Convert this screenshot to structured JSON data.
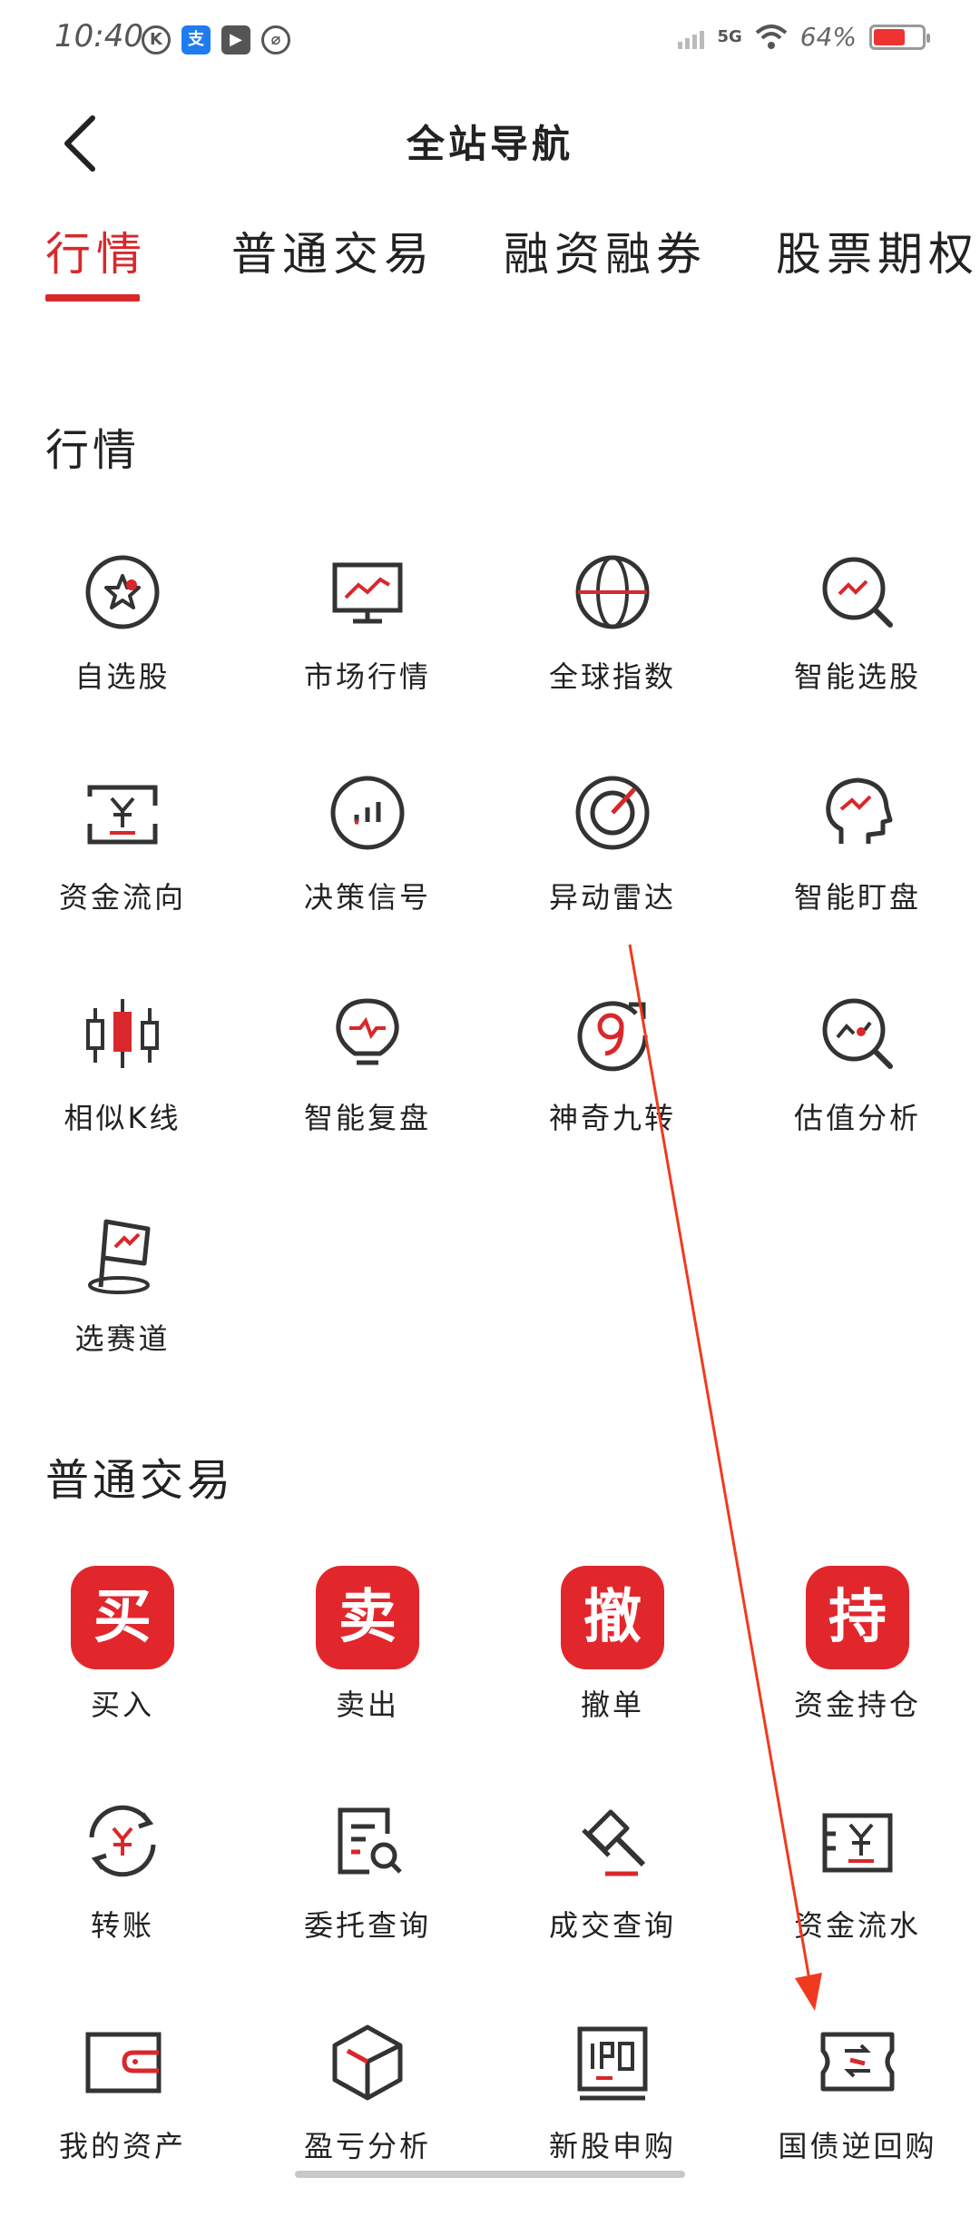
{
  "status_bar": {
    "time": "10:40",
    "network": "5G",
    "battery": "64%",
    "left_icons": [
      "k-circle-icon",
      "alipay-icon",
      "play-icon",
      "leaf-icon"
    ]
  },
  "header": {
    "title": "全站导航"
  },
  "tabs": [
    {
      "label": "行情",
      "active": true
    },
    {
      "label": "普通交易",
      "active": false
    },
    {
      "label": "融资融券",
      "active": false
    },
    {
      "label": "股票期权",
      "active": false
    }
  ],
  "sections": {
    "market": {
      "title": "行情",
      "items": [
        {
          "label": "自选股",
          "icon": "star-circle-icon"
        },
        {
          "label": "市场行情",
          "icon": "monitor-chart-icon"
        },
        {
          "label": "全球指数",
          "icon": "globe-icon"
        },
        {
          "label": "智能选股",
          "icon": "magnifier-chart-icon"
        },
        {
          "label": "资金流向",
          "icon": "yen-flow-icon"
        },
        {
          "label": "决策信号",
          "icon": "bar-signal-icon"
        },
        {
          "label": "异动雷达",
          "icon": "radar-icon"
        },
        {
          "label": "智能盯盘",
          "icon": "head-chart-icon"
        },
        {
          "label": "相似K线",
          "icon": "candlestick-icon"
        },
        {
          "label": "智能复盘",
          "icon": "bulb-chart-icon"
        },
        {
          "label": "神奇九转",
          "icon": "nine-arrow-icon"
        },
        {
          "label": "估值分析",
          "icon": "magnifier-dot-icon"
        },
        {
          "label": "选赛道",
          "icon": "flag-track-icon"
        }
      ]
    },
    "trade": {
      "title": "普通交易",
      "items": [
        {
          "label": "买入",
          "icon": "buy-tile-icon",
          "tile": "买"
        },
        {
          "label": "卖出",
          "icon": "sell-tile-icon",
          "tile": "卖"
        },
        {
          "label": "撤单",
          "icon": "cancel-tile-icon",
          "tile": "撤"
        },
        {
          "label": "资金持仓",
          "icon": "hold-tile-icon",
          "tile": "持"
        },
        {
          "label": "转账",
          "icon": "yen-transfer-icon"
        },
        {
          "label": "委托查询",
          "icon": "document-search-icon"
        },
        {
          "label": "成交查询",
          "icon": "gavel-icon"
        },
        {
          "label": "资金流水",
          "icon": "yen-statement-icon"
        },
        {
          "label": "我的资产",
          "icon": "wallet-icon"
        },
        {
          "label": "盈亏分析",
          "icon": "cube-icon"
        },
        {
          "label": "新股申购",
          "icon": "ipo-icon"
        },
        {
          "label": "国债逆回购",
          "icon": "ticket-exchange-icon"
        }
      ]
    }
  },
  "colors": {
    "accent": "#d8282c",
    "tile_red": "#e2272c",
    "icon_stroke": "#333333",
    "arrow": "#f03a1f"
  }
}
